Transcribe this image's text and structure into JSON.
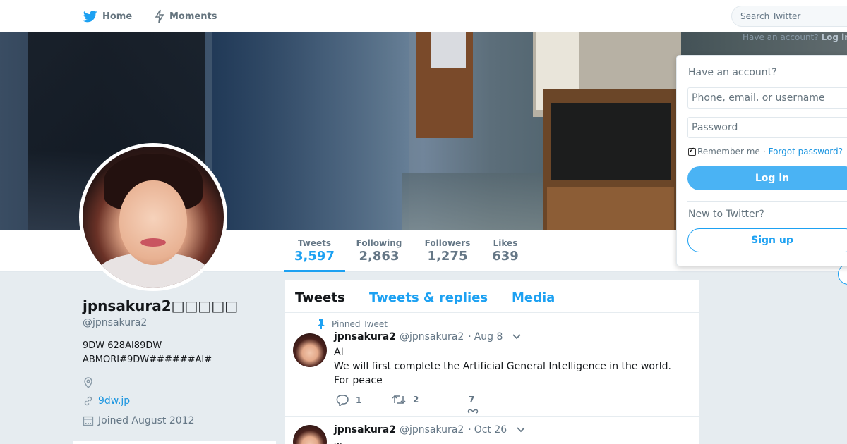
{
  "nav": {
    "home_label": "Home",
    "moments_label": "Moments",
    "search_placeholder": "Search Twitter",
    "ghost_have_account": "Have an account?",
    "ghost_login": "Log in"
  },
  "profile": {
    "display_name": "jpnsakura2□□□□□",
    "handle": "@jpnsakura2",
    "bio_line1": "9DW 628AI89DW",
    "bio_line2": "ABMORI#9DW######AI#",
    "location": "",
    "url_text": "9dw.jp",
    "joined": "Joined August 2012"
  },
  "stats": [
    {
      "label": "Tweets",
      "value": "3,597"
    },
    {
      "label": "Following",
      "value": "2,863"
    },
    {
      "label": "Followers",
      "value": "1,275"
    },
    {
      "label": "Likes",
      "value": "639"
    }
  ],
  "timeline": {
    "tabs": [
      "Tweets",
      "Tweets & replies",
      "Media"
    ],
    "active_tab": "Tweets",
    "tweets": [
      {
        "pinned_label": "Pinned Tweet",
        "name": "jpnsakura2",
        "handle": "@jpnsakura2",
        "dot": "·",
        "date": "Aug 8",
        "text_line1": "AI",
        "text_line2": "We will first complete the Artificial General Intelligence in the world.",
        "text_line3": "For peace",
        "replies": "1",
        "retweets": "2",
        "likes": "7"
      },
      {
        "name": "jpnsakura2",
        "handle": "@jpnsakura2",
        "dot": "·",
        "date": "Oct 26",
        "text_line1": "w"
      }
    ]
  },
  "login_panel": {
    "title": "Have an account?",
    "username_placeholder": "Phone, email, or username",
    "password_placeholder": "Password",
    "remember_label": "Remember me",
    "separator": "·",
    "forgot_label": "Forgot password?",
    "login_button": "Log in",
    "new_label": "New to Twitter?",
    "signup_button": "Sign up"
  },
  "colors": {
    "accent": "#1da1f2",
    "background": "#e6ecf0",
    "text": "#14171a",
    "muted": "#657786"
  },
  "icons": [
    "twitter-bird-icon",
    "moments-bolt-icon",
    "pin-icon",
    "location-icon",
    "link-icon",
    "calendar-icon",
    "reply-icon",
    "retweet-icon",
    "heart-icon",
    "chevron-down-icon"
  ]
}
